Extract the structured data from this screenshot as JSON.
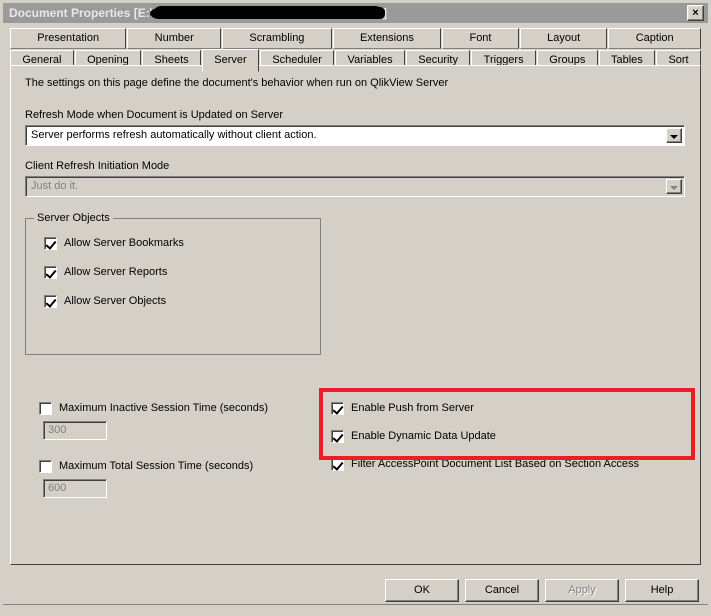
{
  "window": {
    "title_prefix": "Document Properties [E:\\",
    "title_suffix": "]",
    "title_redacted": true,
    "close_label": "×"
  },
  "tabs": {
    "row1": [
      {
        "label": "Presentation",
        "selected": false
      },
      {
        "label": "Number",
        "selected": false
      },
      {
        "label": "Scrambling",
        "selected": false
      },
      {
        "label": "Extensions",
        "selected": false
      },
      {
        "label": "Font",
        "selected": false
      },
      {
        "label": "Layout",
        "selected": false
      },
      {
        "label": "Caption",
        "selected": false
      }
    ],
    "row2": [
      {
        "label": "General",
        "selected": false
      },
      {
        "label": "Opening",
        "selected": false
      },
      {
        "label": "Sheets",
        "selected": false
      },
      {
        "label": "Server",
        "selected": true
      },
      {
        "label": "Scheduler",
        "selected": false
      },
      {
        "label": "Variables",
        "selected": false
      },
      {
        "label": "Security",
        "selected": false
      },
      {
        "label": "Triggers",
        "selected": false
      },
      {
        "label": "Groups",
        "selected": false
      },
      {
        "label": "Tables",
        "selected": false
      },
      {
        "label": "Sort",
        "selected": false
      }
    ]
  },
  "page": {
    "intro": "The settings on this page define the document's behavior when run on QlikView Server",
    "refresh_mode": {
      "label": "Refresh Mode when Document is Updated on Server",
      "value": "Server performs refresh automatically without client action.",
      "disabled": false
    },
    "client_refresh": {
      "label": "Client Refresh Initiation Mode",
      "value": "Just do it.",
      "disabled": true
    },
    "server_objects": {
      "title": "Server Objects",
      "items": [
        {
          "label": "Allow Server Bookmarks",
          "checked": true
        },
        {
          "label": "Allow Server Reports",
          "checked": true
        },
        {
          "label": "Allow Server Objects",
          "checked": true
        }
      ]
    },
    "session_limits": [
      {
        "label": "Maximum Inactive Session Time (seconds)",
        "checked": false,
        "value": "300"
      },
      {
        "label": "Maximum Total Session Time (seconds)",
        "checked": false,
        "value": "600"
      }
    ],
    "right_options": [
      {
        "label": "Enable Push from Server",
        "checked": true
      },
      {
        "label": "Enable Dynamic Data Update",
        "checked": true
      },
      {
        "label": "Filter AccessPoint Document List Based on Section Access",
        "checked": true
      }
    ],
    "highlight_color": "#ee1c24"
  },
  "buttons": [
    {
      "label": "OK",
      "disabled": false
    },
    {
      "label": "Cancel",
      "disabled": false
    },
    {
      "label": "Apply",
      "disabled": true
    },
    {
      "label": "Help",
      "disabled": false
    }
  ]
}
